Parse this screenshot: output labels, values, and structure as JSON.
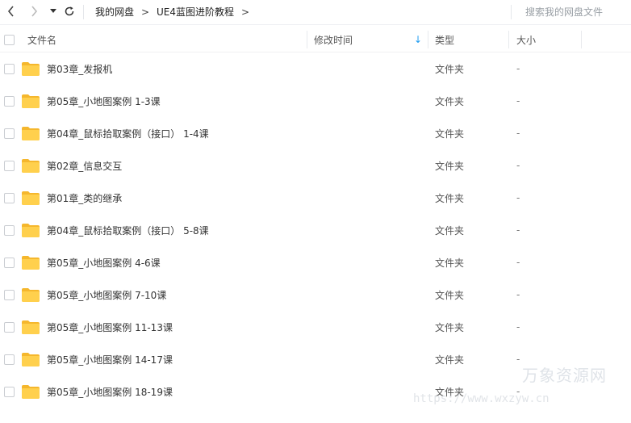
{
  "breadcrumb": {
    "root": "我的网盘",
    "separator": ">",
    "current": "UE4蓝图进阶教程",
    "trailing": ">"
  },
  "search": {
    "placeholder": "搜索我的网盘文件"
  },
  "columns": {
    "name": "文件名",
    "modified": "修改时间",
    "type": "类型",
    "size": "大小"
  },
  "sort_indicator": "↓",
  "files": [
    {
      "name": "第03章_发报机",
      "type": "文件夹",
      "size": "-"
    },
    {
      "name": "第05章_小地图案例 1-3课",
      "type": "文件夹",
      "size": "-"
    },
    {
      "name": "第04章_鼠标拾取案例（接口） 1-4课",
      "type": "文件夹",
      "size": "-"
    },
    {
      "name": "第02章_信息交互",
      "type": "文件夹",
      "size": "-"
    },
    {
      "name": "第01章_类的继承",
      "type": "文件夹",
      "size": "-"
    },
    {
      "name": "第04章_鼠标拾取案例（接口） 5-8课",
      "type": "文件夹",
      "size": "-"
    },
    {
      "name": "第05章_小地图案例 4-6课",
      "type": "文件夹",
      "size": "-"
    },
    {
      "name": "第05章_小地图案例 7-10课",
      "type": "文件夹",
      "size": "-"
    },
    {
      "name": "第05章_小地图案例 11-13课",
      "type": "文件夹",
      "size": "-"
    },
    {
      "name": "第05章_小地图案例 14-17课",
      "type": "文件夹",
      "size": "-"
    },
    {
      "name": "第05章_小地图案例 18-19课",
      "type": "文件夹",
      "size": "-"
    }
  ],
  "watermark": {
    "brand": "万象资源网",
    "url": "https://www.wxzyw.cn"
  },
  "colors": {
    "folder": "#FFD04D",
    "folder_tab": "#F5B72D",
    "sort_arrow": "#1E9BF0",
    "watermark": "#DFE3E8"
  },
  "icons": [
    "back-arrow-icon",
    "forward-arrow-icon",
    "dropdown-icon",
    "refresh-icon",
    "folder-icon"
  ]
}
